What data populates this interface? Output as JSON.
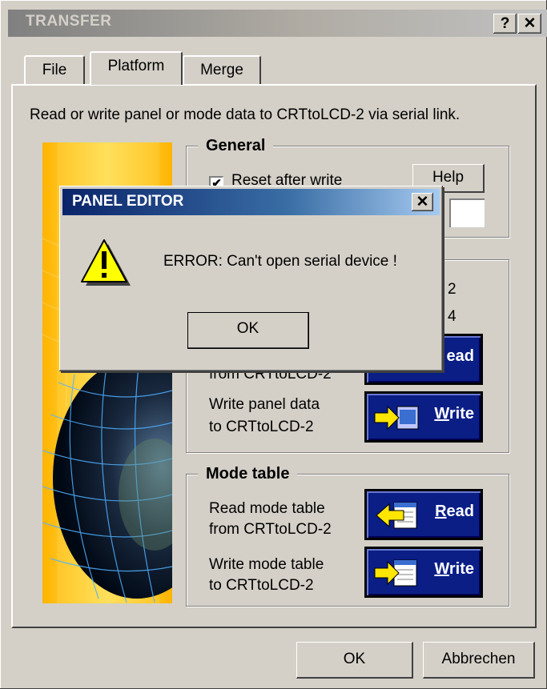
{
  "window": {
    "title": "TRANSFER",
    "help_btn": "?",
    "close_btn": "✕"
  },
  "tabs": [
    {
      "label": "File"
    },
    {
      "label": "Platform"
    },
    {
      "label": "Merge"
    }
  ],
  "description": "Read or write panel or mode data to CRTtoLCD-2 via serial link.",
  "general": {
    "title": "General",
    "reset_checkbox": {
      "label": "Reset after write",
      "checked": true,
      "mark": "✔"
    },
    "help_button": "Help"
  },
  "panel": {
    "partial_2": "2",
    "partial_4": "4",
    "read_label_partial": "from CRTtoLCD-2",
    "read_button": "ead",
    "write_label_line1": "Write panel data",
    "write_label_line2": "to CRTtoLCD-2",
    "write_button_key": "W",
    "write_button_rest": "rite"
  },
  "mode_table": {
    "title": "Mode table",
    "read_label_line1": "Read mode table",
    "read_label_line2": "from CRTtoLCD-2",
    "read_button_key": "R",
    "read_button_rest": "ead",
    "write_label_line1": "Write mode table",
    "write_label_line2": "to CRTtoLCD-2",
    "write_button_key": "W",
    "write_button_rest": "rite"
  },
  "footer": {
    "ok": "OK",
    "cancel": "Abbrechen"
  },
  "dialog": {
    "title": "PANEL EDITOR",
    "close": "✕",
    "icon": "warning-icon",
    "message": "ERROR: Can't open serial device !",
    "ok": "OK"
  },
  "colors": {
    "face": "#d4d0c8",
    "button_blue": "#0a1e86",
    "banner_gold": "#ffc000",
    "dialog_title": "#0a246a"
  }
}
